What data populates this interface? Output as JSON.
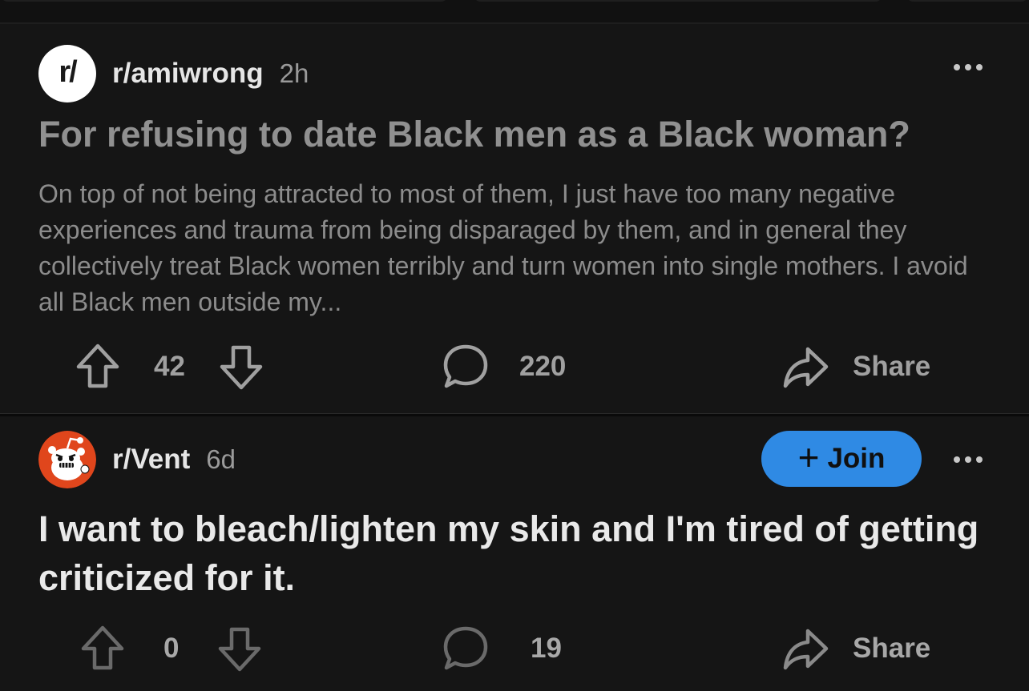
{
  "posts": [
    {
      "subreddit": "r/amiwrong",
      "avatar_text": "r/",
      "age": "2h",
      "title": "For refusing to date Black men as a Black woman?",
      "body": "On top of not being attracted to most of them, I just have too many negative experiences and trauma from being disparaged by them, and in general they collectively treat Black women terribly and turn women into single mothers. I avoid all Black men outside my...",
      "votes": "42",
      "comments": "220",
      "share_label": "Share",
      "more_icon": "ellipsis-icon"
    },
    {
      "subreddit": "r/Vent",
      "age": "6d",
      "join_label": "Join",
      "title": "I want to bleach/lighten my skin and I'm tired of getting criticized for it.",
      "votes": "0",
      "comments": "19",
      "share_label": "Share",
      "more_icon": "ellipsis-icon"
    }
  ],
  "colors": {
    "background": "#111111",
    "card": "#151515",
    "join_button": "#2f8ae4",
    "muted_text": "#8c8c8c",
    "title_text": "#e9e9e9"
  }
}
